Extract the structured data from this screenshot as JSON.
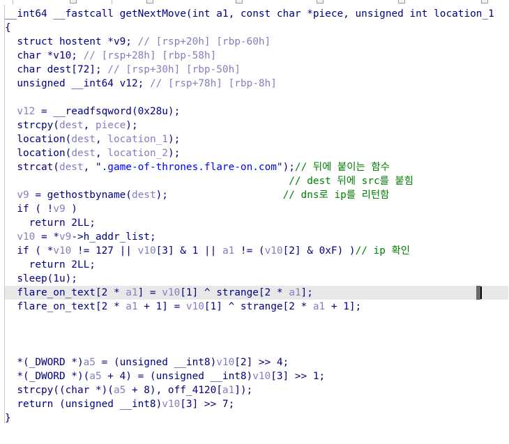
{
  "editor": {
    "lines": [
      {
        "id": "l1",
        "parts": [
          [
            "k",
            "__int64 __fastcall getNextMove(int a1, const char *piece, unsigned int location_1"
          ]
        ]
      },
      {
        "id": "l2",
        "parts": [
          [
            "k",
            "{"
          ]
        ]
      },
      {
        "id": "l3",
        "parts": [
          [
            "k",
            "  struct hostent *v9; "
          ],
          [
            "v",
            "// [rsp+20h] [rbp-60h]"
          ]
        ]
      },
      {
        "id": "l4",
        "parts": [
          [
            "k",
            "  char *v10; "
          ],
          [
            "v",
            "// [rsp+28h] [rbp-58h]"
          ]
        ]
      },
      {
        "id": "l5",
        "parts": [
          [
            "k",
            "  char dest[72]; "
          ],
          [
            "v",
            "// [rsp+30h] [rbp-50h]"
          ]
        ]
      },
      {
        "id": "l6",
        "parts": [
          [
            "k",
            "  unsigned __int64 v12; "
          ],
          [
            "v",
            "// [rsp+78h] [rbp-8h]"
          ]
        ]
      },
      {
        "id": "l7",
        "parts": [
          [
            "k",
            ""
          ]
        ]
      },
      {
        "id": "l8",
        "parts": [
          [
            "v",
            "  v12"
          ],
          [
            "k",
            " = __readfsqword(0x28u);"
          ]
        ]
      },
      {
        "id": "l9",
        "parts": [
          [
            "k",
            "  strcpy("
          ],
          [
            "v",
            "dest"
          ],
          [
            "k",
            ", "
          ],
          [
            "v",
            "piece"
          ],
          [
            "k",
            ");"
          ]
        ]
      },
      {
        "id": "l10",
        "parts": [
          [
            "k",
            "  location("
          ],
          [
            "v",
            "dest"
          ],
          [
            "k",
            ", "
          ],
          [
            "v",
            "location_1"
          ],
          [
            "k",
            ");"
          ]
        ]
      },
      {
        "id": "l11",
        "parts": [
          [
            "k",
            "  location("
          ],
          [
            "v",
            "dest"
          ],
          [
            "k",
            ", "
          ],
          [
            "v",
            "location_2"
          ],
          [
            "k",
            ");"
          ]
        ]
      },
      {
        "id": "l12",
        "parts": [
          [
            "k",
            "  strcat("
          ],
          [
            "v",
            "dest"
          ],
          [
            "k",
            ", \""
          ],
          [
            "n",
            ".game-of-thrones.flare-on.com"
          ],
          [
            "k",
            "\");"
          ],
          [
            "c",
            "// 뒤에 붙이는 함수"
          ]
        ]
      },
      {
        "id": "l13",
        "parts": [
          [
            "k",
            "                                               "
          ],
          [
            "c",
            "// dest 뒤에 src를 붙힘"
          ]
        ]
      },
      {
        "id": "l14",
        "parts": [
          [
            "v",
            "  v9"
          ],
          [
            "k",
            " = gethostbyname("
          ],
          [
            "v",
            "dest"
          ],
          [
            "k",
            ");"
          ],
          [
            "k",
            "                   "
          ],
          [
            "c",
            "// dns로 ip를 리턴함"
          ]
        ]
      },
      {
        "id": "l15",
        "parts": [
          [
            "k",
            "  if ( !"
          ],
          [
            "v",
            "v9"
          ],
          [
            "k",
            " )"
          ]
        ]
      },
      {
        "id": "l16",
        "parts": [
          [
            "k",
            "    return 2LL;"
          ]
        ]
      },
      {
        "id": "l17",
        "parts": [
          [
            "v",
            "  v10"
          ],
          [
            "k",
            " = *"
          ],
          [
            "v",
            "v9"
          ],
          [
            "k",
            "->h_addr_list;"
          ]
        ]
      },
      {
        "id": "l18",
        "parts": [
          [
            "k",
            "  if ( *"
          ],
          [
            "v",
            "v10"
          ],
          [
            "k",
            " != 127 || "
          ],
          [
            "v",
            "v10"
          ],
          [
            "k",
            "[3] & 1 || "
          ],
          [
            "v",
            "a1"
          ],
          [
            "k",
            " != ("
          ],
          [
            "v",
            "v10"
          ],
          [
            "k",
            "[2] & 0xF) )"
          ],
          [
            "c",
            "// ip 확인"
          ]
        ]
      },
      {
        "id": "l19",
        "parts": [
          [
            "k",
            "    return 2LL;"
          ]
        ]
      },
      {
        "id": "l20",
        "parts": [
          [
            "k",
            "  sleep(1u);"
          ]
        ]
      },
      {
        "id": "l21",
        "parts": [
          [
            "k",
            "  flare_on_text[2 * "
          ],
          [
            "v",
            "a1"
          ],
          [
            "k",
            "] = "
          ],
          [
            "v",
            "v10"
          ],
          [
            "k",
            "[1] ^ strange[2 * "
          ],
          [
            "v",
            "a1"
          ],
          [
            "k",
            "];"
          ]
        ],
        "highlight": true
      },
      {
        "id": "l22",
        "parts": [
          [
            "k",
            "  flare_on_text[2 * "
          ],
          [
            "v",
            "a1"
          ],
          [
            "k",
            " + 1] = "
          ],
          [
            "v",
            "v10"
          ],
          [
            "k",
            "[1] ^ strange[2 * "
          ],
          [
            "v",
            "a1"
          ],
          [
            "k",
            " + 1];"
          ]
        ]
      },
      {
        "id": "l23",
        "parts": [
          [
            "k",
            ""
          ]
        ]
      },
      {
        "id": "l24",
        "parts": [
          [
            "k",
            ""
          ]
        ]
      },
      {
        "id": "l25",
        "parts": [
          [
            "k",
            ""
          ]
        ]
      },
      {
        "id": "l26",
        "parts": [
          [
            "k",
            "  *(_DWORD *)"
          ],
          [
            "v",
            "a5"
          ],
          [
            "k",
            " = (unsigned __int8)"
          ],
          [
            "v",
            "v10"
          ],
          [
            "k",
            "[2] >> 4;"
          ]
        ]
      },
      {
        "id": "l27",
        "parts": [
          [
            "k",
            "  *(_DWORD *)("
          ],
          [
            "v",
            "a5"
          ],
          [
            "k",
            " + 4) = (unsigned __int8)"
          ],
          [
            "v",
            "v10"
          ],
          [
            "k",
            "[3] >> 1;"
          ]
        ]
      },
      {
        "id": "l28",
        "parts": [
          [
            "k",
            "  strcpy((char *)("
          ],
          [
            "v",
            "a5"
          ],
          [
            "k",
            " + 8), off_4120["
          ],
          [
            "v",
            "a1"
          ],
          [
            "k",
            "]);"
          ]
        ]
      },
      {
        "id": "l29",
        "parts": [
          [
            "k",
            "  return (unsigned __int8)"
          ],
          [
            "v",
            "v10"
          ],
          [
            "k",
            "[3] >> 7;"
          ]
        ]
      },
      {
        "id": "l30",
        "parts": [
          [
            "k",
            "}"
          ]
        ]
      }
    ]
  },
  "colors": {
    "keyword": "#000080",
    "variable": "#8080c0",
    "string": "#0000ff",
    "comment": "#008000",
    "highlight": "#e8e8e8"
  }
}
